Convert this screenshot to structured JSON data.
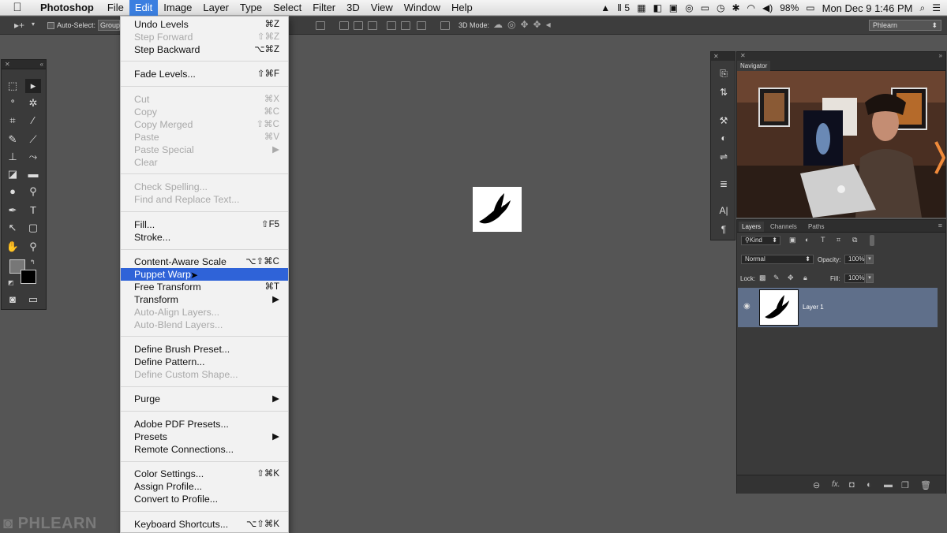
{
  "menubar": {
    "app": "Photoshop",
    "items": [
      "File",
      "Edit",
      "Image",
      "Layer",
      "Type",
      "Select",
      "Filter",
      "3D",
      "View",
      "Window",
      "Help"
    ],
    "status": {
      "adobe_badge": "5",
      "battery": "98%",
      "datetime": "Mon Dec 9  1:46 PM"
    }
  },
  "options": {
    "auto_select": "Auto-Select:",
    "group": "Group",
    "mode_3d": "3D Mode:",
    "workspace": "Phlearn"
  },
  "edit_menu": {
    "undo": {
      "label": "Undo Levels",
      "sc": "⌘Z"
    },
    "step_forward": {
      "label": "Step Forward",
      "sc": "⇧⌘Z"
    },
    "step_backward": {
      "label": "Step Backward",
      "sc": "⌥⌘Z"
    },
    "fade": {
      "label": "Fade Levels...",
      "sc": "⇧⌘F"
    },
    "cut": {
      "label": "Cut",
      "sc": "⌘X"
    },
    "copy": {
      "label": "Copy",
      "sc": "⌘C"
    },
    "copy_merged": {
      "label": "Copy Merged",
      "sc": "⇧⌘C"
    },
    "paste": {
      "label": "Paste",
      "sc": "⌘V"
    },
    "paste_special": {
      "label": "Paste Special",
      "sc": "▶"
    },
    "clear": {
      "label": "Clear"
    },
    "check_spelling": {
      "label": "Check Spelling..."
    },
    "find_replace": {
      "label": "Find and Replace Text..."
    },
    "fill": {
      "label": "Fill...",
      "sc": "⇧F5"
    },
    "stroke": {
      "label": "Stroke..."
    },
    "content_aware": {
      "label": "Content-Aware Scale",
      "sc": "⌥⇧⌘C"
    },
    "puppet_warp": {
      "label": "Puppet Warp"
    },
    "free_transform": {
      "label": "Free Transform",
      "sc": "⌘T"
    },
    "transform": {
      "label": "Transform",
      "sc": "▶"
    },
    "auto_align": {
      "label": "Auto-Align Layers..."
    },
    "auto_blend": {
      "label": "Auto-Blend Layers..."
    },
    "brush_preset": {
      "label": "Define Brush Preset..."
    },
    "define_pattern": {
      "label": "Define Pattern..."
    },
    "custom_shape": {
      "label": "Define Custom Shape..."
    },
    "purge": {
      "label": "Purge",
      "sc": "▶"
    },
    "pdf_presets": {
      "label": "Adobe PDF Presets..."
    },
    "presets": {
      "label": "Presets",
      "sc": "▶"
    },
    "remote": {
      "label": "Remote Connections..."
    },
    "color_settings": {
      "label": "Color Settings...",
      "sc": "⇧⌘K"
    },
    "assign_profile": {
      "label": "Assign Profile..."
    },
    "convert_profile": {
      "label": "Convert to Profile..."
    },
    "keyboard": {
      "label": "Keyboard Shortcuts...",
      "sc": "⌥⇧⌘K"
    }
  },
  "navigator": {
    "tab": "Navigator"
  },
  "layers_panel": {
    "tabs": [
      "Layers",
      "Channels",
      "Paths"
    ],
    "kind": "Kind",
    "blend_mode": "Normal",
    "opacity_label": "Opacity:",
    "opacity": "100%",
    "lock_label": "Lock:",
    "fill_label": "Fill:",
    "fill": "100%",
    "layer_name": "Layer 1",
    "footer_fx": "fx."
  },
  "watermark": "PHLEARN",
  "colors": {
    "highlight": "#2f63d8",
    "menu_active": "#3b7fe0",
    "selected_layer": "#5f6f8a"
  }
}
